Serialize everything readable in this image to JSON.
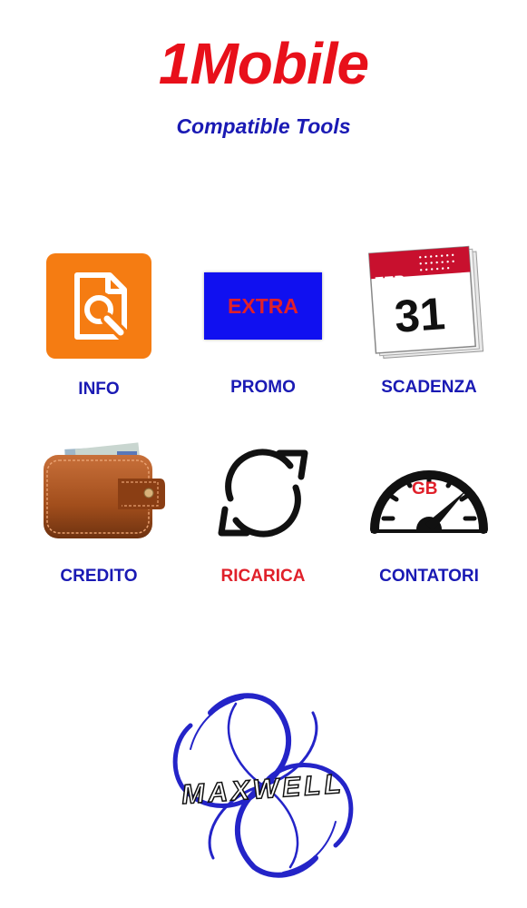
{
  "header": {
    "title": "1Mobile",
    "subtitle": "Compatible Tools"
  },
  "tiles": [
    {
      "label": "INFO",
      "icon": "document-search-icon"
    },
    {
      "label": "PROMO",
      "icon": "extra-badge-icon",
      "badge_text": "EXTRA"
    },
    {
      "label": "SCADENZA",
      "icon": "calendar-icon",
      "month": "FEB",
      "day": "31"
    },
    {
      "label": "CREDITO",
      "icon": "wallet-icon"
    },
    {
      "label": "RICARICA",
      "icon": "refresh-icon"
    },
    {
      "label": "CONTATORI",
      "icon": "speedometer-icon",
      "unit": "GB"
    }
  ],
  "footer": {
    "logo_text": "MAXWELL",
    "icon": "swirl-logo-icon"
  },
  "colors": {
    "title": "#e8101a",
    "accent_blue": "#1a1ab4",
    "accent_red": "#e0202a",
    "info_orange": "#f57c12",
    "promo_blue": "#1010f0"
  }
}
